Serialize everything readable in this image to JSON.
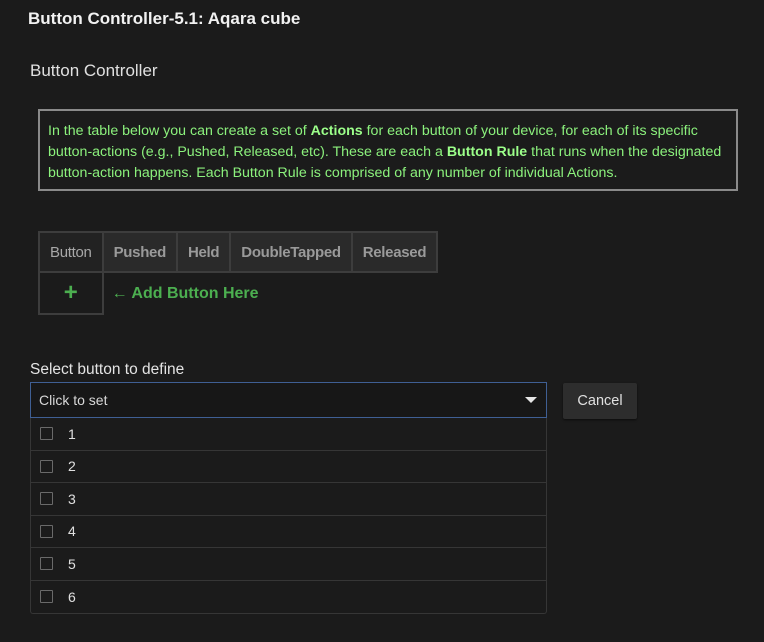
{
  "page": {
    "title": "Button Controller-5.1: Aqara cube"
  },
  "section": {
    "title": "Button Controller"
  },
  "info": {
    "part1": "In the table below you can create a set of ",
    "bold1": "Actions",
    "part2": " for each button of your device, for each of its specific button-actions (e.g., Pushed, Released, etc).  These are each a ",
    "bold2": "Button Rule",
    "part3": " that runs when the designated button-action happens.  Each Button Rule is comprised of any number of individual Actions."
  },
  "table": {
    "headers": [
      "Button",
      "Pushed",
      "Held",
      "DoubleTapped",
      "Released"
    ],
    "plus_label": "+",
    "add_label": "← Add Button Here"
  },
  "selector": {
    "label": "Select button to define",
    "placeholder": "Click to set",
    "options": [
      "1",
      "2",
      "3",
      "4",
      "5",
      "6"
    ]
  },
  "cancel_label": "Cancel",
  "colors": {
    "background": "#1b1b1b",
    "info_text": "#8cf27d",
    "accent_green": "#4caf50",
    "select_border": "#3f5f94"
  }
}
